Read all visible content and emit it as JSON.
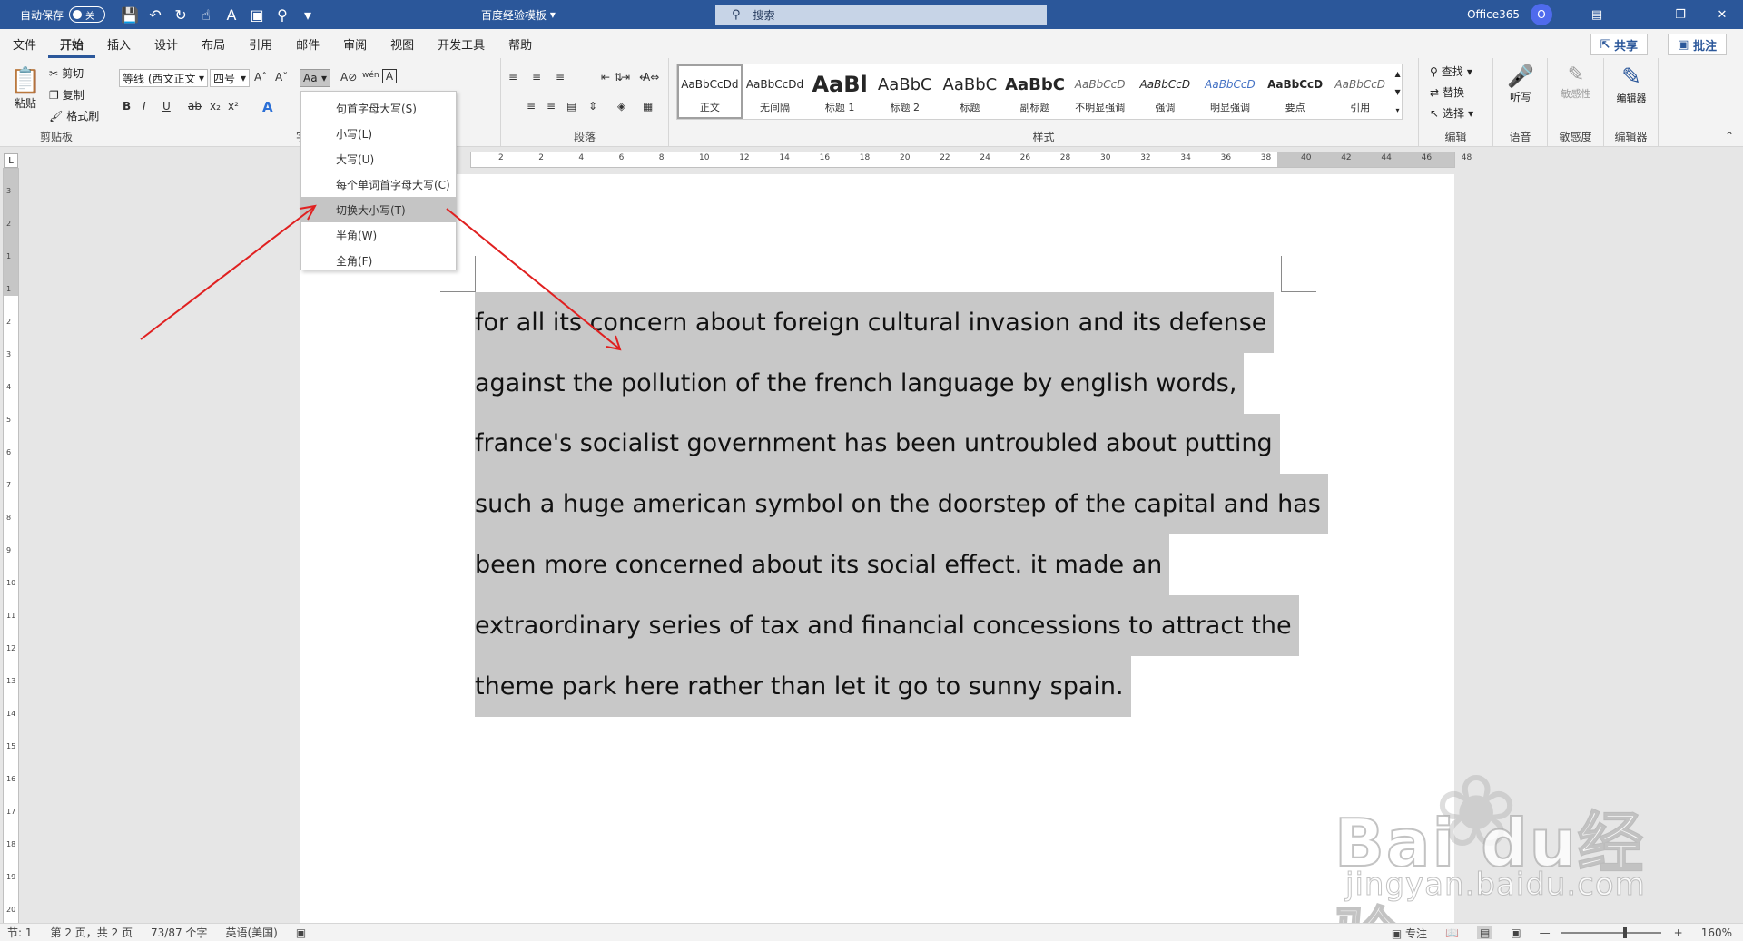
{
  "titlebar": {
    "autosave_label": "自动保存",
    "autosave_state": "关",
    "doc_title": "百度经验模板",
    "search_placeholder": "搜索",
    "account": "Office365",
    "avatar_initial": "O"
  },
  "menu": {
    "tabs": [
      "文件",
      "开始",
      "插入",
      "设计",
      "布局",
      "引用",
      "邮件",
      "审阅",
      "视图",
      "开发工具",
      "帮助"
    ],
    "share": "共享",
    "comments": "批注"
  },
  "ribbon": {
    "clipboard": {
      "paste": "粘贴",
      "cut": "剪切",
      "copy": "复制",
      "format_painter": "格式刷",
      "label": "剪贴板"
    },
    "font": {
      "font_name": "等线 (西文正文",
      "font_size": "四号",
      "label": "字体",
      "case_button": "Aa"
    },
    "paragraph": {
      "label": "段落"
    },
    "styles": {
      "label": "样式",
      "items": [
        {
          "preview": "AaBbCcDd",
          "name": "正文"
        },
        {
          "preview": "AaBbCcDd",
          "name": "无间隔"
        },
        {
          "preview": "AaBl",
          "name": "标题 1"
        },
        {
          "preview": "AaBbC",
          "name": "标题 2"
        },
        {
          "preview": "AaBbC",
          "name": "标题"
        },
        {
          "preview": "AaBbC",
          "name": "副标题"
        },
        {
          "preview": "AaBbCcD",
          "name": "不明显强调"
        },
        {
          "preview": "AaBbCcD",
          "name": "强调"
        },
        {
          "preview": "AaBbCcD",
          "name": "明显强调"
        },
        {
          "preview": "AaBbCcD",
          "name": "要点"
        },
        {
          "preview": "AaBbCcD",
          "name": "引用"
        }
      ]
    },
    "editing": {
      "find": "查找",
      "replace": "替换",
      "select": "选择",
      "label": "编辑"
    },
    "voice": {
      "dictate": "听写",
      "label": "语音"
    },
    "sensitivity": {
      "button": "敏感性",
      "label": "敏感度"
    },
    "editor": {
      "button": "编辑器",
      "label": "编辑器"
    }
  },
  "case_menu": {
    "items": [
      "句首字母大写(S)",
      "小写(L)",
      "大写(U)",
      "每个单词首字母大写(C)",
      "切换大小写(T)",
      "半角(W)",
      "全角(F)"
    ],
    "highlighted_index": 4
  },
  "document": {
    "lines": [
      "for all its concern about foreign cultural invasion and its defense",
      "against the pollution of the french language by english words,",
      "france's socialist government has been untroubled about putting",
      "such a huge american symbol on the doorstep of the capital and has",
      "been more concerned about its social effect. it made an",
      "extraordinary series of tax and financial concessions to attract the",
      "theme park here rather than let it go to sunny spain."
    ]
  },
  "ruler": {
    "h_ticks": [
      "2",
      "2",
      "4",
      "6",
      "8",
      "10",
      "12",
      "14",
      "16",
      "18",
      "20",
      "22",
      "24",
      "26",
      "28",
      "30",
      "32",
      "34",
      "36",
      "38",
      "40",
      "42",
      "44",
      "46",
      "48"
    ],
    "v_ticks": [
      "3",
      "2",
      "1",
      "1",
      "2",
      "3",
      "4",
      "5",
      "6",
      "7",
      "8",
      "9",
      "10",
      "11",
      "12",
      "13",
      "14",
      "15",
      "16",
      "17",
      "18",
      "19",
      "20"
    ]
  },
  "statusbar": {
    "section": "节: 1",
    "page": "第 2 页，共 2 页",
    "words": "73/87 个字",
    "language": "英语(美国)",
    "focus": "专注",
    "zoom": "160%"
  },
  "watermark": {
    "main": "Bai du经验",
    "sub": "jingyan.baidu.com"
  },
  "colors": {
    "title_bar": "#2b579a",
    "selection": "#c8c8c8",
    "arrow": "#e02020"
  }
}
